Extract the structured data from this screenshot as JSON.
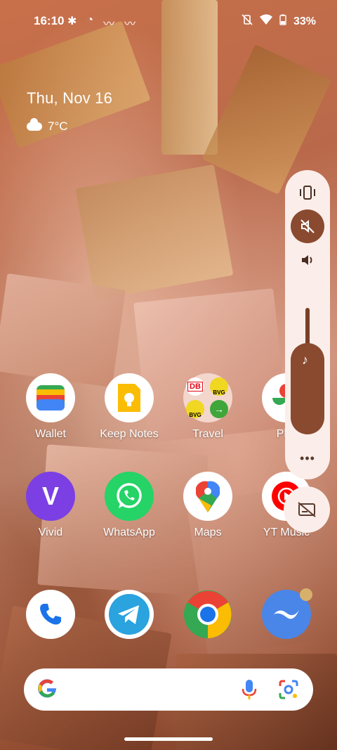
{
  "status_bar": {
    "time": "16:10",
    "battery": "33%",
    "left_icons": [
      "slack-icon",
      "dnd-icon",
      "app-icon",
      "app-icon"
    ],
    "right_icons": [
      "vibrate-off-icon",
      "wifi-icon",
      "battery-icon"
    ]
  },
  "glance": {
    "date": "Thu, Nov 16",
    "temperature": "7°C",
    "weather_icon": "cloud-icon"
  },
  "apps": {
    "row1": [
      {
        "label": "Wallet",
        "icon": "wallet-icon"
      },
      {
        "label": "Keep Notes",
        "icon": "keep-notes-icon"
      },
      {
        "label": "Travel",
        "icon": "folder-icon"
      },
      {
        "label": "Pho",
        "icon": "photos-icon"
      }
    ],
    "row2": [
      {
        "label": "Vivid",
        "icon": "vivid-icon"
      },
      {
        "label": "WhatsApp",
        "icon": "whatsapp-icon"
      },
      {
        "label": "Maps",
        "icon": "maps-icon"
      },
      {
        "label": "YT Music",
        "icon": "yt-music-icon"
      }
    ],
    "dock": [
      {
        "icon": "phone-icon"
      },
      {
        "icon": "telegram-icon"
      },
      {
        "icon": "chrome-icon"
      },
      {
        "icon": "app-icon"
      }
    ],
    "travel_folder_labels": [
      "DB",
      "BVG",
      "BVG"
    ]
  },
  "volume_panel": {
    "more": "•••",
    "ring_mode": "muted",
    "media_level": 0.7
  },
  "search": {
    "logo": "G"
  },
  "colors": {
    "panel_bg": "#fbeeea",
    "accent": "#8a4a30"
  }
}
